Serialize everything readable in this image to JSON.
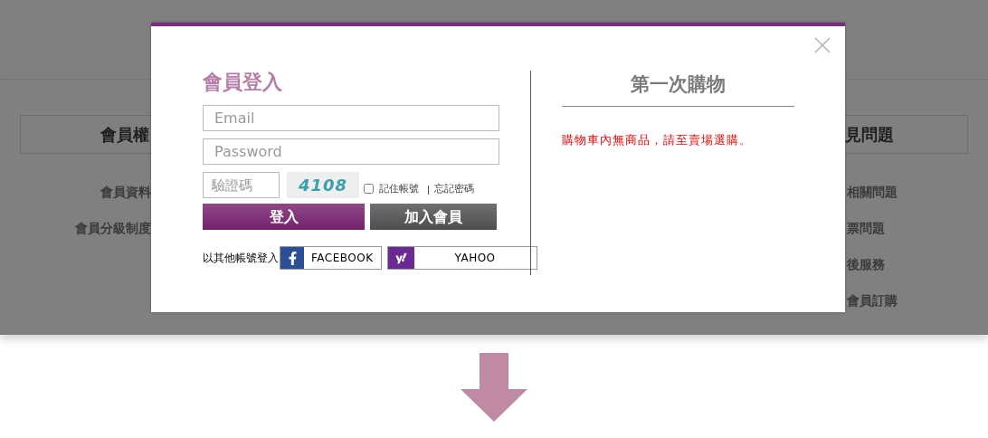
{
  "background_page": {
    "left_column": {
      "heading": "會員權",
      "items": [
        "會員資料",
        "會員分級制度"
      ]
    },
    "right_column": {
      "heading": "見問題",
      "items": [
        "相關問題",
        "票問題",
        "後服務",
        "會員訂購"
      ]
    }
  },
  "login_dialog": {
    "login": {
      "title": "會員登入",
      "email": {
        "placeholder": "Email"
      },
      "password": {
        "placeholder": "Password"
      },
      "captcha": {
        "placeholder": "驗證碼"
      },
      "captcha_code": "4108",
      "remember": {
        "label": "記住帳號",
        "checked": false
      },
      "forgot_link": "忘記密碼",
      "login_button": "登入",
      "join_button": "加入會員",
      "social_label": "以其他帳號登入",
      "social_buttons": [
        {
          "kind": "facebook",
          "label": "FACEBOOK"
        },
        {
          "kind": "yahoo",
          "label": "YAHOO"
        }
      ]
    },
    "first_purchase": {
      "title": "第一次購物",
      "message": "購物車內無商品，請至賣場選購。"
    }
  }
}
